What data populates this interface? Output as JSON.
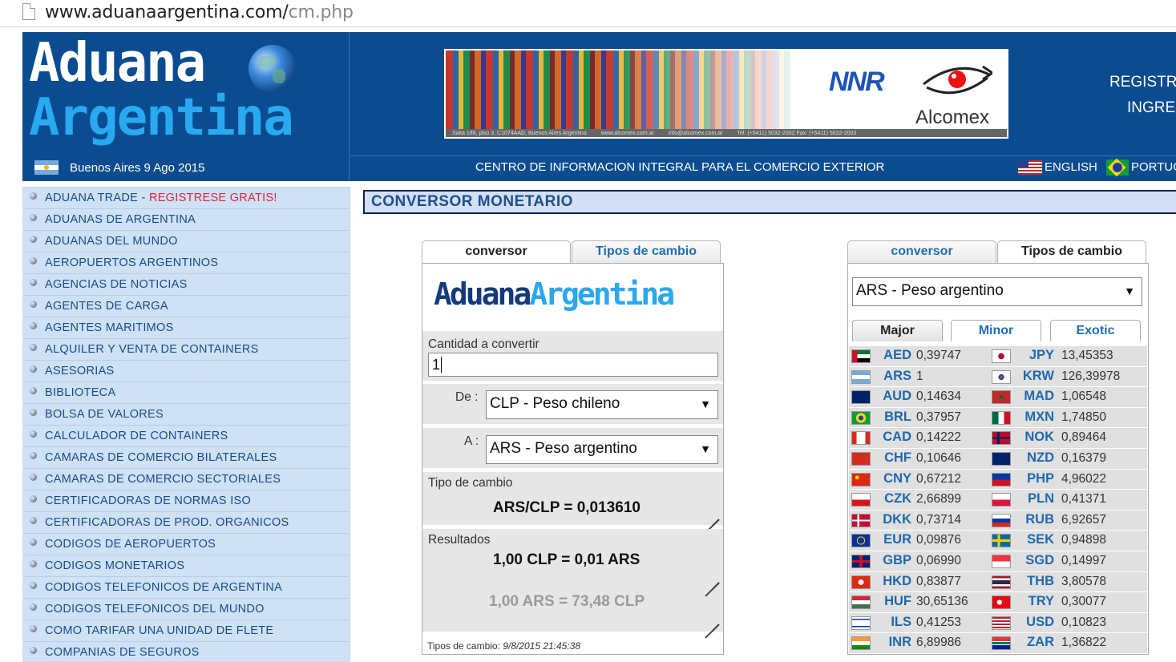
{
  "browser": {
    "url_host": "www.aduanaargentina.com/",
    "url_path": "cm.php"
  },
  "header": {
    "logo_line1": "Aduana",
    "logo_line2": "Argentina",
    "date": "Buenos Aires 9 Ago 2015",
    "banner": {
      "brand1": "NNR",
      "brand2": "Alcomex",
      "strip": [
        "Salta 188, piso 3, C1074AAD, Buenos Aires Argentina",
        "www.alcomex.com.ar",
        "info@alcomex.com.ar",
        "Tel: (+5411) 5032-2002 Fax: (+5411) 5032-2003"
      ]
    },
    "register": "REGISTR",
    "login": "INGRE",
    "tagline": "CENTRO DE INFORMACION INTEGRAL PARA EL COMERCIO EXTERIOR",
    "lang_english": "ENGLISH",
    "lang_portuguese": "PORTUG"
  },
  "sidebar": {
    "first": {
      "prefix": "ADUANA TRADE - ",
      "highlight": "REGISTRESE GRATIS!"
    },
    "items": [
      "ADUANAS DE ARGENTINA",
      "ADUANAS DEL MUNDO",
      "AEROPUERTOS ARGENTINOS",
      "AGENCIAS DE NOTICIAS",
      "AGENTES DE CARGA",
      "AGENTES MARITIMOS",
      "ALQUILER Y VENTA DE CONTAINERS",
      "ASESORIAS",
      "BIBLIOTECA",
      "BOLSA DE VALORES",
      "CALCULADOR DE CONTAINERS",
      "CAMARAS DE COMERCIO BILATERALES",
      "CAMARAS DE COMERCIO SECTORIALES",
      "CERTIFICADORAS DE NORMAS ISO",
      "CERTIFICADORAS DE PROD. ORGANICOS",
      "CODIGOS DE AEROPUERTOS",
      "CODIGOS MONETARIOS",
      "CODIGOS TELEFONICOS DE ARGENTINA",
      "CODIGOS TELEFONICOS DEL MUNDO",
      "COMO TARIFAR UNA UNIDAD DE FLETE",
      "COMPANIAS DE SEGUROS"
    ]
  },
  "main": {
    "title": "CONVERSOR MONETARIO"
  },
  "converter": {
    "tab_conversor": "conversor",
    "tab_tipos": "Tipos de cambio",
    "logo_a": "Aduana",
    "logo_b": "Argentina",
    "amount_label": "Cantidad a convertir",
    "amount_value": "1",
    "from_label": "De :",
    "from_value": "CLP - Peso chileno",
    "to_label": "A :",
    "to_value": "ARS - Peso argentino",
    "rate_label": "Tipo de cambio",
    "rate_value": "ARS/CLP = 0,013610",
    "results_label": "Resultados",
    "result_main": "1,00 CLP = 0,01 ARS",
    "result_inverse": "1,00 ARS = 73,48 CLP",
    "footer_label": "Tipos de cambio:",
    "footer_value": "9/8/2015 21:45:38"
  },
  "rates": {
    "tab_conversor": "conversor",
    "tab_tipos": "Tipos de cambio",
    "base_select": "ARS - Peso argentino",
    "subtab_major": "Major",
    "subtab_minor": "Minor",
    "subtab_exotic": "Exotic",
    "rows": [
      {
        "l_code": "AED",
        "l_val": "0,39747",
        "l_flag": "uae-flag-icon",
        "r_code": "JPY",
        "r_val": "13,45353",
        "r_flag": "japan-flag-icon"
      },
      {
        "l_code": "ARS",
        "l_val": "1",
        "l_flag": "argentina-flag-icon",
        "r_code": "KRW",
        "r_val": "126,39978",
        "r_flag": "korea-flag-icon"
      },
      {
        "l_code": "AUD",
        "l_val": "0,14634",
        "l_flag": "australia-flag-icon",
        "r_code": "MAD",
        "r_val": "1,06548",
        "r_flag": "morocco-flag-icon"
      },
      {
        "l_code": "BRL",
        "l_val": "0,37957",
        "l_flag": "brazil-flag-icon",
        "r_code": "MXN",
        "r_val": "1,74850",
        "r_flag": "mexico-flag-icon"
      },
      {
        "l_code": "CAD",
        "l_val": "0,14222",
        "l_flag": "canada-flag-icon",
        "r_code": "NOK",
        "r_val": "0,89464",
        "r_flag": "norway-flag-icon"
      },
      {
        "l_code": "CHF",
        "l_val": "0,10646",
        "l_flag": "switzerland-flag-icon",
        "r_code": "NZD",
        "r_val": "0,16379",
        "r_flag": "new-zealand-flag-icon"
      },
      {
        "l_code": "CNY",
        "l_val": "0,67212",
        "l_flag": "china-flag-icon",
        "r_code": "PHP",
        "r_val": "4,96022",
        "r_flag": "philippines-flag-icon"
      },
      {
        "l_code": "CZK",
        "l_val": "2,66899",
        "l_flag": "czech-flag-icon",
        "r_code": "PLN",
        "r_val": "0,41371",
        "r_flag": "poland-flag-icon"
      },
      {
        "l_code": "DKK",
        "l_val": "0,73714",
        "l_flag": "denmark-flag-icon",
        "r_code": "RUB",
        "r_val": "6,92657",
        "r_flag": "russia-flag-icon"
      },
      {
        "l_code": "EUR",
        "l_val": "0,09876",
        "l_flag": "eu-flag-icon",
        "r_code": "SEK",
        "r_val": "0,94898",
        "r_flag": "sweden-flag-icon"
      },
      {
        "l_code": "GBP",
        "l_val": "0,06990",
        "l_flag": "uk-flag-icon",
        "r_code": "SGD",
        "r_val": "0,14997",
        "r_flag": "singapore-flag-icon"
      },
      {
        "l_code": "HKD",
        "l_val": "0,83877",
        "l_flag": "hong-kong-flag-icon",
        "r_code": "THB",
        "r_val": "3,80578",
        "r_flag": "thailand-flag-icon"
      },
      {
        "l_code": "HUF",
        "l_val": "30,65136",
        "l_flag": "hungary-flag-icon",
        "r_code": "TRY",
        "r_val": "0,30077",
        "r_flag": "turkey-flag-icon"
      },
      {
        "l_code": "ILS",
        "l_val": "0,41253",
        "l_flag": "israel-flag-icon",
        "r_code": "USD",
        "r_val": "0,10823",
        "r_flag": "usa-flag-icon"
      },
      {
        "l_code": "INR",
        "l_val": "6,89986",
        "l_flag": "india-flag-icon",
        "r_code": "ZAR",
        "r_val": "1,36822",
        "r_flag": "south-africa-flag-icon"
      }
    ]
  },
  "colors": {
    "header_blue": "#0b4c91",
    "link_blue": "#1e68ad",
    "sidebar_bg": "#cfe1f5",
    "highlight_red": "#e0233a"
  }
}
